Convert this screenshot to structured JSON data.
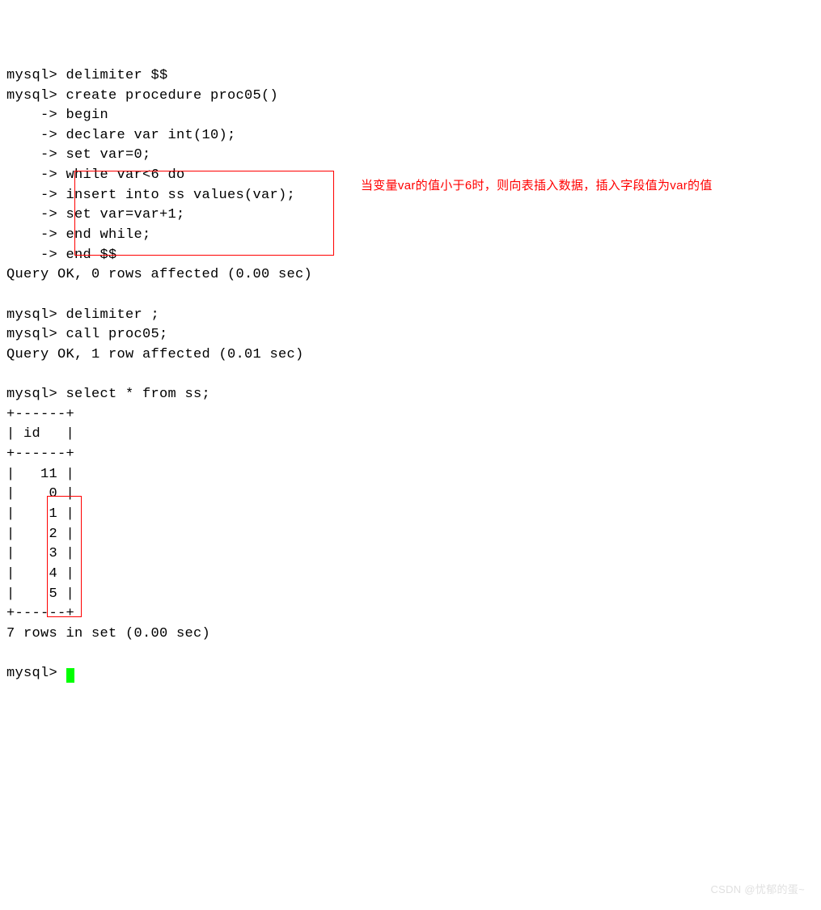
{
  "terminal": {
    "line1": "mysql> delimiter $$",
    "line2": "mysql> create procedure proc05()",
    "line3": "    -> begin",
    "line4": "    -> declare var int(10);",
    "line5": "    -> set var=0;",
    "line6": "    -> while var<6 do",
    "line7": "    -> insert into ss values(var);",
    "line8": "    -> set var=var+1;",
    "line9": "    -> end while;",
    "line10": "    -> end $$",
    "line11": "Query OK, 0 rows affected (0.00 sec)",
    "line12": "",
    "line13": "mysql> delimiter ;",
    "line14": "mysql> call proc05;",
    "line15": "Query OK, 1 row affected (0.01 sec)",
    "line16": "",
    "line17": "mysql> select * from ss;",
    "line18": "+------+",
    "line19": "| id   |",
    "line20": "+------+",
    "line21": "|   11 |",
    "line22": "|    0 |",
    "line23": "|    1 |",
    "line24": "|    2 |",
    "line25": "|    3 |",
    "line26": "|    4 |",
    "line27": "|    5 |",
    "line28": "+------+",
    "line29": "7 rows in set (0.00 sec)",
    "line30": "",
    "line31": "mysql> "
  },
  "annotation": "当变量var的值小于6时，则向表插入数据，插入字段值为var的值",
  "watermark": "CSDN @忧郁的蛋~"
}
